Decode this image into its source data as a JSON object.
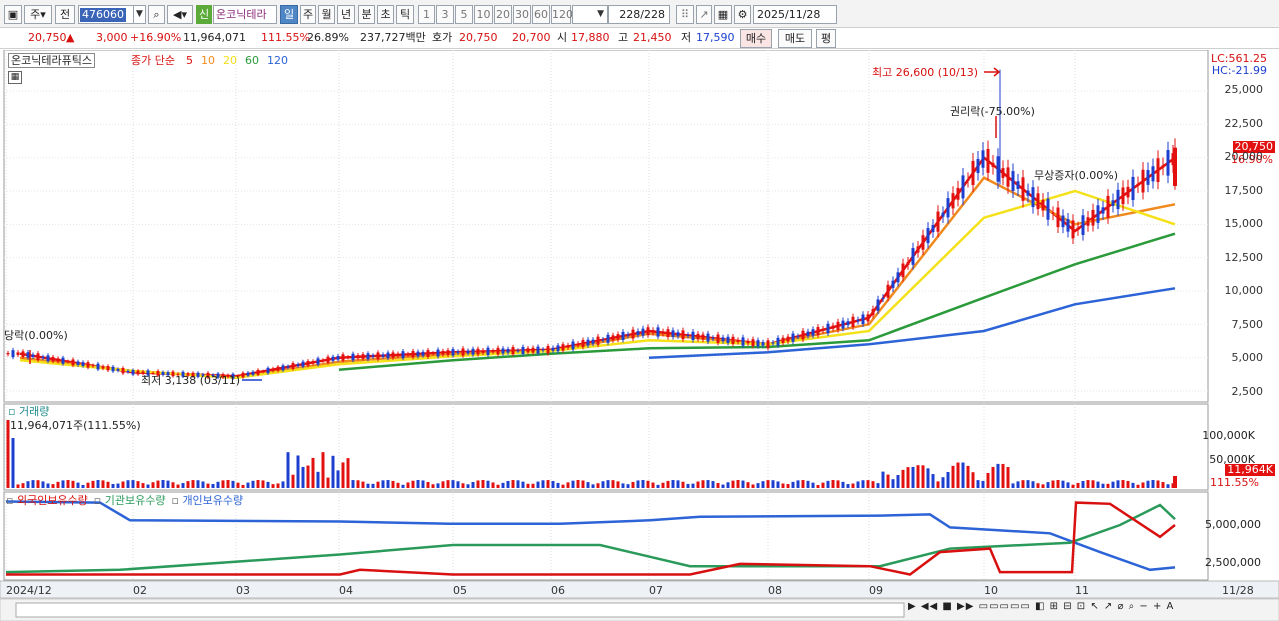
{
  "toolbar": {
    "period_btn": "주",
    "prev_btn": "전",
    "code": "476060",
    "shin_badge": "신",
    "stock_name": "온코닉테라",
    "timeframes": [
      "일",
      "주",
      "월",
      "년",
      "분",
      "초",
      "틱"
    ],
    "active_timeframe": "일",
    "ranges": [
      "1",
      "3",
      "5",
      "10",
      "20",
      "30",
      "60",
      "120"
    ],
    "count": "228/228",
    "date": "2025/11/28"
  },
  "quote": {
    "price": "20,750",
    "change": "3,000",
    "change_pct": "+16.90%",
    "volume": "11,964,071",
    "vol_ratio": "111.55%",
    "turnover": "26.89%",
    "amount": "237,727백만",
    "ask_label": "호가",
    "ask": "20,750",
    "bid": "20,700",
    "open_label": "시",
    "open": "17,880",
    "high_label": "고",
    "high": "21,450",
    "low_label": "저",
    "low": "17,590",
    "buy_btn": "매수",
    "sell_btn": "매도",
    "eval_btn": "평"
  },
  "price_panel": {
    "stock_label": "온코닉테라퓨틱스",
    "ma_label": "종가 단순",
    "ma_periods": [
      {
        "p": "5",
        "color": "#e31010"
      },
      {
        "p": "10",
        "color": "#f08a1e"
      },
      {
        "p": "20",
        "color": "#f5e11a"
      },
      {
        "p": "60",
        "color": "#2a9a3a"
      },
      {
        "p": "120",
        "color": "#2c63d6"
      }
    ],
    "lc": "LC:561.25",
    "hc": "HC:-21.99",
    "annot_high": "최고 26,600 (10/13)",
    "annot_low": "최저 3,138 (03/11)",
    "annot_rights": "권리락(-75.00%)",
    "annot_lock_left": "당락(0.00%)",
    "annot_bonus": "무상증자(0.00%)",
    "price_tag": "20,750",
    "pct_tag": "16.90%",
    "y_ticks": [
      "25,000",
      "22,500",
      "20,000",
      "17,500",
      "15,000",
      "12,500",
      "10,000",
      "7,500",
      "5,000",
      "2,500"
    ]
  },
  "volume_panel": {
    "title": "거래량",
    "value_label": "11,964,071주(111.55%)",
    "y_ticks": [
      "100,000K",
      "50,000K"
    ],
    "vol_tag": "11,964K",
    "pct_tag": "111.55%"
  },
  "holdings_panel": {
    "series": [
      {
        "name": "외국인보유수량",
        "color": "#d81010"
      },
      {
        "name": "기관보유수량",
        "color": "#2a9a5a"
      },
      {
        "name": "개인보유수량",
        "color": "#2c63d6"
      }
    ],
    "y_ticks": [
      "5,000,000",
      "2,500,000"
    ]
  },
  "x_axis": {
    "labels": [
      "2024/12",
      "02",
      "03",
      "04",
      "05",
      "06",
      "07",
      "08",
      "09",
      "10",
      "11",
      "11/28"
    ]
  },
  "chart_data": {
    "type": "line",
    "title": "",
    "x": [
      "2024/12",
      "02",
      "03",
      "04",
      "05",
      "06",
      "07",
      "08",
      "09",
      "10",
      "11",
      "11/28"
    ],
    "ylim": [
      2500,
      25000
    ],
    "series": [
      {
        "name": "5",
        "values": [
          5300,
          3900,
          3600,
          5000,
          5400,
          5600,
          7000,
          6000,
          8000,
          20000,
          14500,
          20000
        ]
      },
      {
        "name": "10",
        "values": [
          5000,
          4000,
          3500,
          4700,
          5300,
          5500,
          6800,
          6000,
          7500,
          18500,
          15000,
          16500
        ]
      },
      {
        "name": "20",
        "values": [
          4800,
          4000,
          3500,
          4500,
          5100,
          5500,
          6300,
          6000,
          7000,
          15500,
          17500,
          15000
        ]
      },
      {
        "name": "60",
        "values": [
          null,
          null,
          null,
          4100,
          4800,
          5300,
          5700,
          5800,
          6300,
          9500,
          12000,
          14300
        ]
      },
      {
        "name": "120",
        "values": [
          null,
          null,
          null,
          null,
          null,
          null,
          5000,
          5400,
          6000,
          7000,
          9000,
          10200
        ]
      }
    ]
  }
}
